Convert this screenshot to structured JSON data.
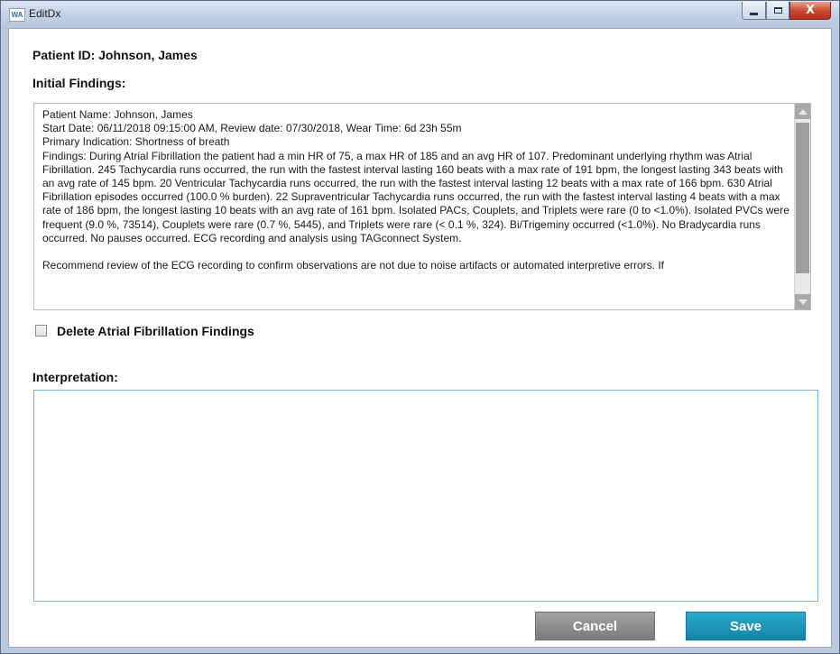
{
  "window": {
    "title": "EditDx",
    "app_icon_text": "WA",
    "minimize_icon": "minimize-icon",
    "maximize_icon": "maximize-icon",
    "close_icon": "close-icon",
    "close_glyph": "X"
  },
  "patient": {
    "id_label": "Patient ID: Johnson, James"
  },
  "initial_findings": {
    "label": "Initial Findings:",
    "lines": [
      "Patient Name: Johnson, James",
      "Start Date: 06/11/2018 09:15:00 AM, Review date: 07/30/2018, Wear Time: 6d 23h 55m",
      "Primary Indication: Shortness of breath",
      "Findings:  During Atrial Fibrillation the patient had a min HR of 75, a max HR of 185 and an avg HR of 107.  Predominant underlying rhythm was Atrial Fibrillation.  245 Tachycardia runs occurred, the run with the fastest interval lasting 160 beats with a max rate of 191 bpm, the longest lasting 343 beats with an avg rate of 145 bpm.  20 Ventricular Tachycardia runs occurred, the run with the fastest interval lasting 12 beats with a max rate of 166 bpm.  630 Atrial Fibrillation episodes occurred (100.0 % burden).  22 Supraventricular Tachycardia runs occurred, the run with the fastest interval lasting 4 beats with a max rate of 186 bpm, the longest lasting 10 beats with an avg rate of 161 bpm.  Isolated PACs, Couplets, and Triplets were rare (0 to <1.0%).  Isolated PVCs were frequent (9.0 %, 73514), Couplets were rare (0.7 %, 5445), and Triplets were rare (< 0.1 %, 324).  Bi/Trigeminy occurred (<1.0%).  No Bradycardia runs occurred.  No pauses occurred.  ECG recording and analysis using TAGconnect System.",
      "",
      "Recommend review of the ECG recording to confirm observations are not due to noise artifacts or automated interpretive errors.  If"
    ]
  },
  "delete_af": {
    "label": "Delete Atrial Fibrillation Findings",
    "checked": false
  },
  "interpretation": {
    "label": "Interpretation:",
    "value": ""
  },
  "buttons": {
    "cancel": "Cancel",
    "save": "Save"
  },
  "colors": {
    "save_accent": "#1a93b8",
    "cancel_gray": "#8c8c8c",
    "focus_border": "#7bb3df"
  }
}
